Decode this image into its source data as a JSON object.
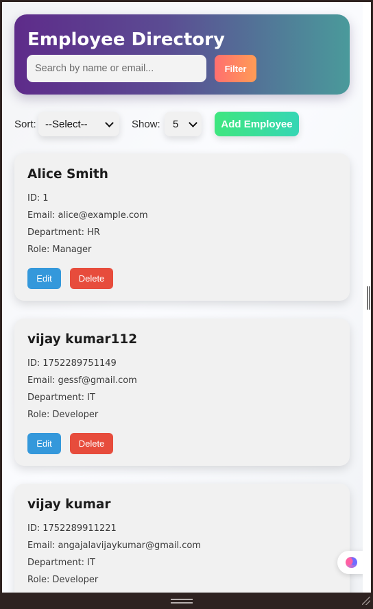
{
  "header": {
    "title": "Employee Directory",
    "search_placeholder": "Search by name or email...",
    "filter_label": "Filter"
  },
  "controls": {
    "sort_label": "Sort:",
    "sort_value": "--Select--",
    "show_label": "Show:",
    "show_value": "5",
    "add_label": "Add Employee"
  },
  "labels": {
    "id": "ID:",
    "email": "Email:",
    "department": "Department:",
    "role": "Role:",
    "edit": "Edit",
    "delete": "Delete"
  },
  "employees": [
    {
      "name": "Alice Smith",
      "id": "1",
      "email": "alice@example.com",
      "department": "HR",
      "role": "Manager"
    },
    {
      "name": "vijay kumar112",
      "id": "1752289751149",
      "email": "gessf@gmail.com",
      "department": "IT",
      "role": "Developer"
    },
    {
      "name": "vijay kumar",
      "id": "1752289911221",
      "email": "angajalavijaykumar@gmail.com",
      "department": "IT",
      "role": "Developer"
    }
  ],
  "icons": {
    "assistant": "brain-icon",
    "select_arrow": "chevron-down-icon"
  },
  "colors": {
    "edit": "#3498db",
    "delete": "#e74c3c",
    "filter": "#ff7f63",
    "add": "#3ee28f"
  }
}
